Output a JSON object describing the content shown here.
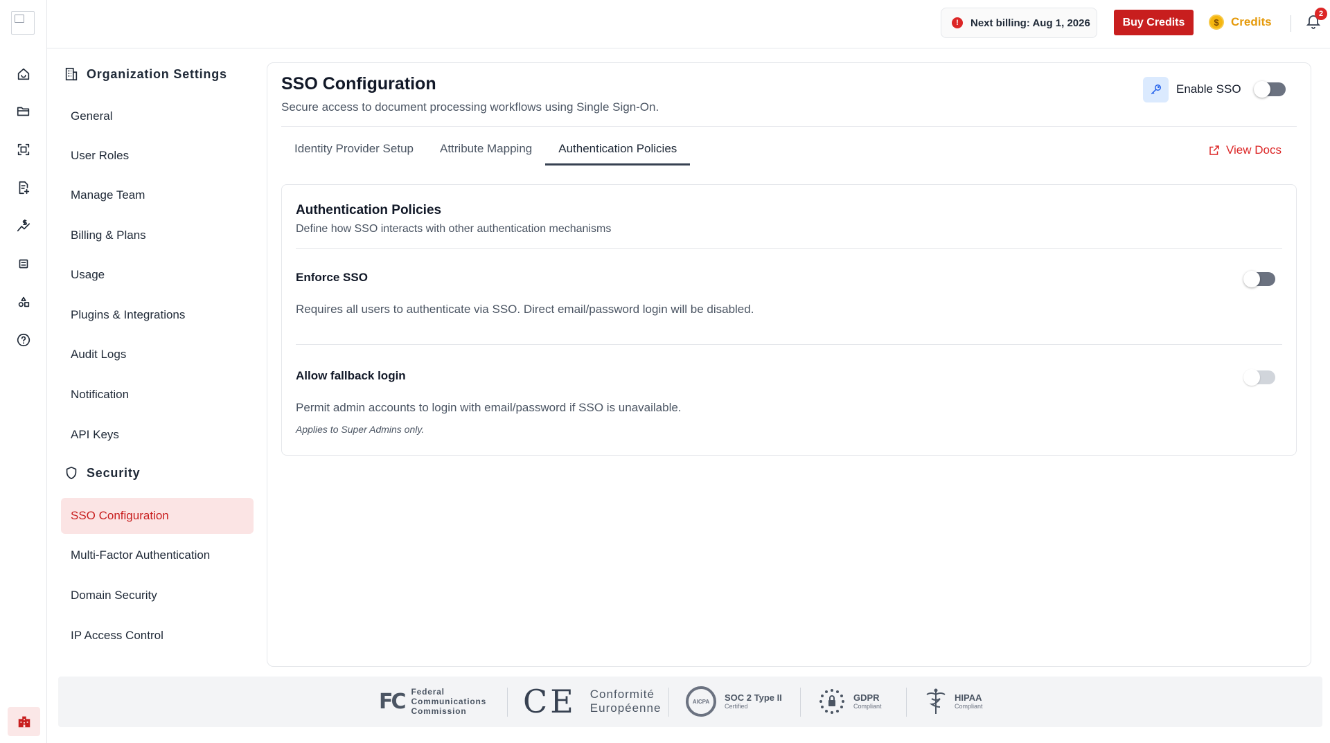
{
  "header": {
    "billing": "Next billing: Aug 1, 2026",
    "buy_credits": "Buy Credits",
    "credits_label": "Credits",
    "credits_coin": "$",
    "notification_count": "2"
  },
  "rail": {
    "items": [
      "home-icon",
      "folder-icon",
      "scan-icon",
      "document-add-icon",
      "dollar-chart-icon",
      "table-icon",
      "shapes-icon",
      "help-circle-icon"
    ]
  },
  "settings_nav": {
    "org_heading": "Organization Settings",
    "org_items": [
      {
        "label": "General"
      },
      {
        "label": "User Roles"
      },
      {
        "label": "Manage Team"
      },
      {
        "label": "Billing & Plans"
      },
      {
        "label": "Usage"
      },
      {
        "label": "Plugins & Integrations"
      },
      {
        "label": "Audit Logs"
      },
      {
        "label": "Notification"
      },
      {
        "label": "API Keys"
      }
    ],
    "security_heading": "Security",
    "security_items": [
      {
        "label": "SSO Configuration",
        "active": true
      },
      {
        "label": "Multi-Factor Authentication"
      },
      {
        "label": "Domain Security"
      },
      {
        "label": "IP Access Control"
      }
    ]
  },
  "main": {
    "title": "SSO Configuration",
    "subtitle": "Secure access to document processing workflows using Single Sign-On.",
    "enable_sso_label": "Enable SSO",
    "enable_sso_on": false,
    "tabs": [
      {
        "label": "Identity Provider Setup",
        "active": false
      },
      {
        "label": "Attribute Mapping",
        "active": false
      },
      {
        "label": "Authentication Policies",
        "active": true
      }
    ],
    "view_docs": "View Docs",
    "policies": {
      "title": "Authentication Policies",
      "subtitle": "Define how SSO interacts with other authentication mechanisms",
      "enforce": {
        "title": "Enforce SSO",
        "desc": "Requires all users to authenticate via SSO. Direct email/password login will be disabled.",
        "on": false
      },
      "fallback": {
        "title": "Allow fallback login",
        "desc": "Permit admin accounts to login with email/password if SSO is unavailable.",
        "note": "Applies to Super Admins only.",
        "on": false,
        "disabled": true
      }
    }
  },
  "compliance": {
    "fcc": {
      "mark": "FC",
      "line1": "Federal",
      "line2": "Communications",
      "line3": "Commission"
    },
    "ce": {
      "mark": "CE",
      "line1": "Conformité",
      "line2": "Européenne"
    },
    "soc": {
      "seal": "AICPA",
      "name": "SOC 2 Type II",
      "sub": "Certified"
    },
    "gdpr": {
      "name": "GDPR",
      "sub": "Compliant"
    },
    "hipaa": {
      "name": "HIPAA",
      "sub": "Compliant"
    }
  },
  "colors": {
    "accent": "#c81e1e",
    "active_bg": "#fbe4e4",
    "credits": "#e59a0b",
    "link": "#dc2626"
  }
}
